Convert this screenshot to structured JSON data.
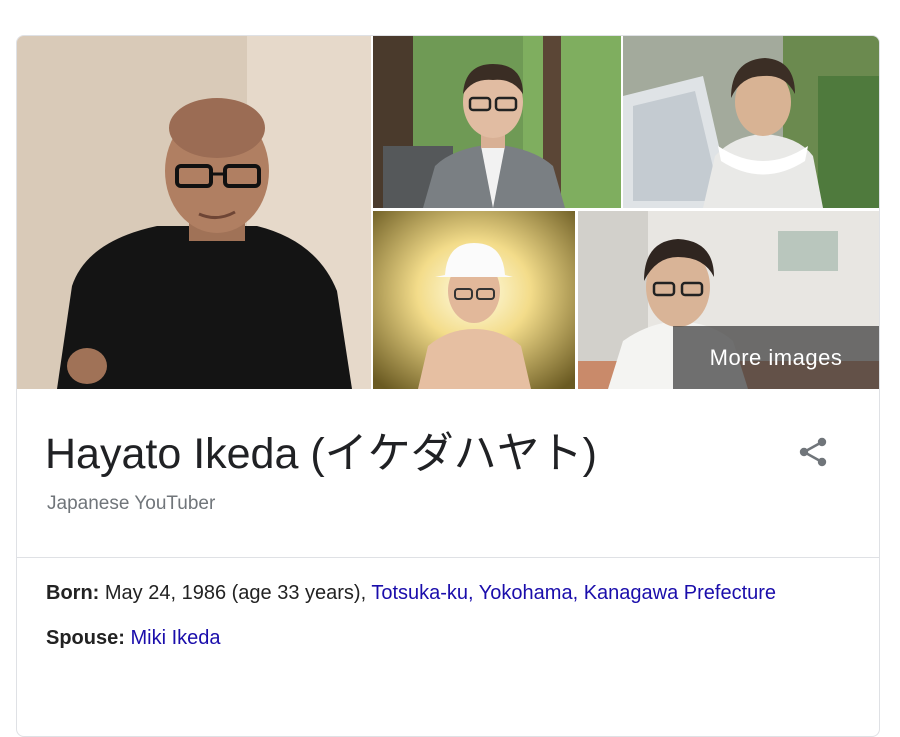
{
  "gallery": {
    "more_images_label": "More images"
  },
  "entity": {
    "title": "Hayato Ikeda (イケダハヤト)",
    "subtitle": "Japanese YouTuber"
  },
  "facts": {
    "born": {
      "label": "Born:",
      "text": " May 24, 1986 (age 33 years), ",
      "place_link": "Totsuka-ku, Yokohama, Kanagawa Prefecture"
    },
    "spouse": {
      "label": "Spouse:",
      "link": "Miki Ikeda"
    }
  },
  "icons": {
    "share": "share-icon"
  },
  "colors": {
    "link": "#1a0dab",
    "title": "#202124",
    "subtitle": "#70757a",
    "border": "#dfe1e5"
  }
}
